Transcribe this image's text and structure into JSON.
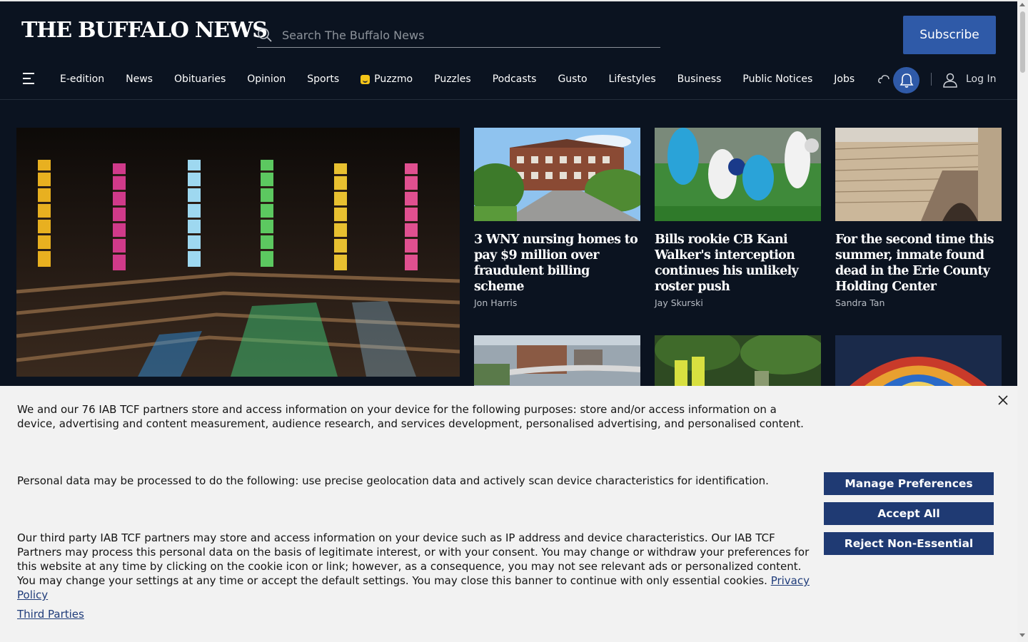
{
  "header": {
    "logo_text": "THE BUFFALO NEWS",
    "search_placeholder": "Search The Buffalo News",
    "subscribe_label": "Subscribe"
  },
  "nav": {
    "items": [
      "E-edition",
      "News",
      "Obituaries",
      "Opinion",
      "Sports",
      "Puzzmo",
      "Puzzles",
      "Podcasts",
      "Gusto",
      "Lifestyles",
      "Business",
      "Public Notices",
      "Jobs"
    ],
    "login_label": "Log In"
  },
  "stories": [
    {
      "title": "3 WNY nursing homes to pay $9 million over fraudulent billing scheme",
      "author": "Jon Harris"
    },
    {
      "title": "Bills rookie CB Kani Walker's interception continues his unlikely roster push",
      "author": "Jay Skurski"
    },
    {
      "title": "For the second time this summer, inmate found dead in the Erie County Holding Center",
      "author": "Sandra Tan"
    }
  ],
  "cookie": {
    "paragraph1": "We and our 76 IAB TCF partners store and access information on your device for the following purposes: store and/or access information on a device, advertising and content measurement, audience research, and services development, personalised advertising, and personalised content.",
    "paragraph2": "Personal data may be processed to do the following: use precise geolocation data and actively scan device characteristics for identification.",
    "paragraph3": "Our third party IAB TCF partners may store and access information on your device such as IP address and device characteristics. Our IAB TCF Partners may process this personal data on the basis of legitimate interest, or with your consent. You may change or withdraw your preferences for this website at any time by clicking on the cookie icon or link; however, as a consequence, you may not see relevant ads or personalized content. You may change your settings at any time or accept the default settings. You may close this banner to continue with only essential cookies.",
    "privacy_link": "Privacy Policy",
    "third_parties_link": "Third Parties",
    "manage_label": "Manage Preferences",
    "accept_label": "Accept All",
    "reject_label": "Reject Non-Essential"
  },
  "colors": {
    "page_bg": "#0b1320",
    "accent": "#2f5aa8",
    "banner_bg": "#f2f2f2",
    "banner_button": "#1f3a73"
  }
}
